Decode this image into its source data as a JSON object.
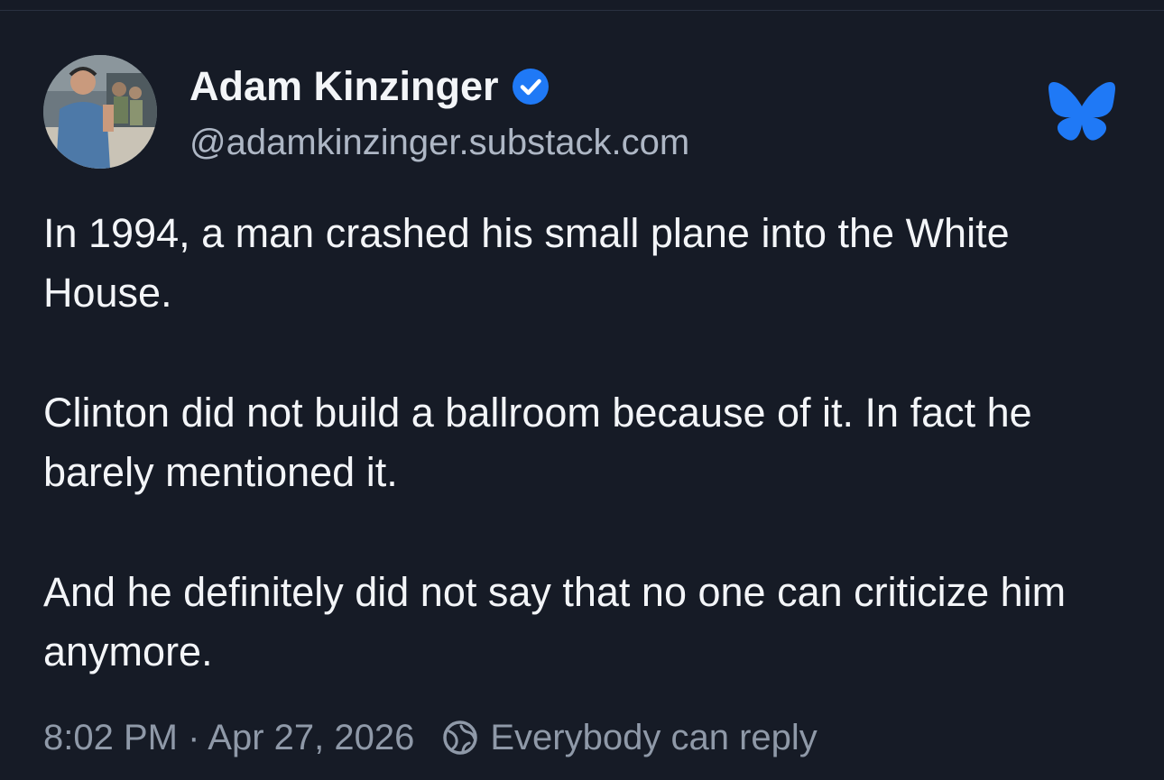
{
  "post": {
    "author": {
      "display_name": "Adam Kinzinger",
      "handle": "@adamkinzinger.substack.com",
      "verified": true
    },
    "paragraphs": [
      "In 1994, a man crashed his small plane into the White House.",
      "Clinton did not build a ballroom because of it.  In fact he barely mentioned it.",
      "And he definitely did not say that no one can criticize him anymore."
    ],
    "timestamp": "8:02 PM · Apr 27, 2026",
    "reply_setting": "Everybody can reply"
  },
  "icons": {
    "verified": "verified-badge-icon",
    "platform": "bluesky-butterfly-icon",
    "reply": "everybody-can-reply-icon"
  },
  "colors": {
    "background": "#161b26",
    "text": "#f3f5f8",
    "secondary_text": "#aeb7c5",
    "meta_text": "#8f99a8",
    "accent_blue": "#1f79f6"
  }
}
